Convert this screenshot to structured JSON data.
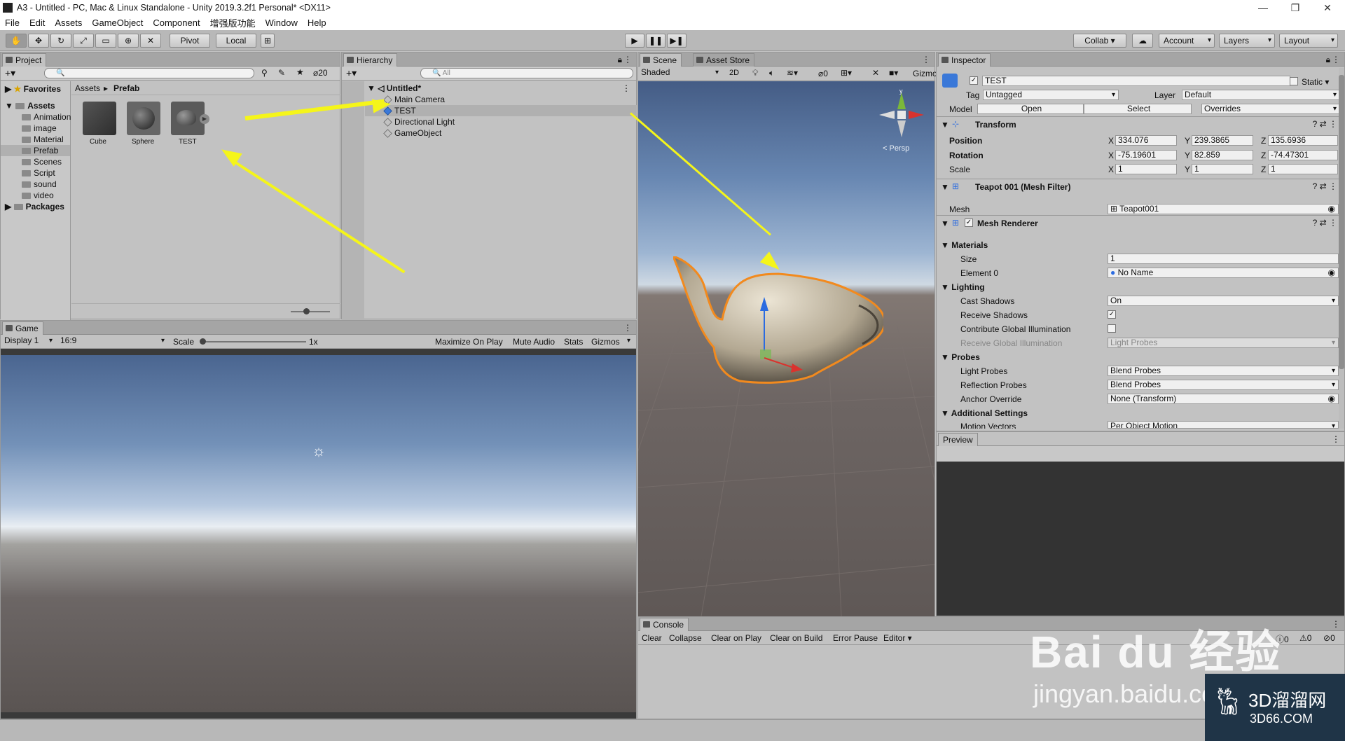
{
  "window": {
    "title": "A3 - Untitled - PC, Mac & Linux Standalone - Unity 2019.3.2f1 Personal* <DX11>",
    "minimize": "—",
    "maximize": "❐",
    "close": "✕"
  },
  "menu": [
    "File",
    "Edit",
    "Assets",
    "GameObject",
    "Component",
    "增强版功能",
    "Window",
    "Help"
  ],
  "toolbar": {
    "pivot": "Pivot",
    "local": "Local",
    "collab": "Collab ▾",
    "account": "Account",
    "layers": "Layers",
    "layout": "Layout"
  },
  "project": {
    "tab": "Project",
    "count": "20",
    "breadcrumb": [
      "Assets",
      "Prefab"
    ],
    "favorites": "Favorites",
    "assets": "Assets",
    "folders": [
      "Animation",
      "image",
      "Material",
      "Prefab",
      "Scenes",
      "Script",
      "sound",
      "video"
    ],
    "packages": "Packages",
    "items": [
      "Cube",
      "Sphere",
      "TEST"
    ]
  },
  "hierarchy": {
    "tab": "Hierarchy",
    "search_placeholder": "All",
    "scene": "Untitled*",
    "objects": [
      "Main Camera",
      "TEST",
      "Directional Light",
      "GameObject"
    ]
  },
  "scene": {
    "tabs": [
      "Scene",
      "Asset Store"
    ],
    "shading": "Shaded",
    "mode2d": "2D",
    "fx_count": "0",
    "gizmos": "Gizmos",
    "persp": "< Persp"
  },
  "game": {
    "tab": "Game",
    "display": "Display 1",
    "aspect": "16:9",
    "scale_label": "Scale",
    "scale_value": "1x",
    "buttons": [
      "Maximize On Play",
      "Mute Audio",
      "Stats",
      "Gizmos"
    ]
  },
  "inspector": {
    "tab": "Inspector",
    "name": "TEST",
    "static": "Static",
    "tag_label": "Tag",
    "tag": "Untagged",
    "layer_label": "Layer",
    "layer": "Default",
    "model_label": "Model",
    "open": "Open",
    "select": "Select",
    "overrides": "Overrides",
    "transform": {
      "title": "Transform",
      "position": {
        "label": "Position",
        "x": "334.076",
        "y": "239.3865",
        "z": "135.6936"
      },
      "rotation": {
        "label": "Rotation",
        "x": "-75.19601",
        "y": "82.859",
        "z": "-74.47301"
      },
      "scale": {
        "label": "Scale",
        "x": "1",
        "y": "1",
        "z": "1"
      }
    },
    "mesh_filter": {
      "title": "Teapot 001 (Mesh Filter)",
      "mesh_label": "Mesh",
      "mesh": "Teapot001"
    },
    "renderer": {
      "title": "Mesh Renderer",
      "materials": "Materials",
      "size_label": "Size",
      "size": "1",
      "element_label": "Element 0",
      "element": "No Name",
      "lighting": "Lighting",
      "cast_label": "Cast Shadows",
      "cast": "On",
      "receive_label": "Receive Shadows",
      "contrib_label": "Contribute Global Illumination",
      "receive_gi_label": "Receive Global Illumination",
      "receive_gi": "Light Probes",
      "probes": "Probes",
      "light_probes_label": "Light Probes",
      "light_probes": "Blend Probes",
      "refl_label": "Reflection Probes",
      "refl": "Blend Probes",
      "anchor_label": "Anchor Override",
      "anchor": "None (Transform)",
      "additional": "Additional Settings",
      "motion_label": "Motion Vectors",
      "motion": "Per Object Motion"
    },
    "preview": "Preview"
  },
  "console": {
    "tab": "Console",
    "buttons": [
      "Clear",
      "Collapse",
      "Clear on Play",
      "Clear on Build",
      "Error Pause",
      "Editor ▾"
    ],
    "counts": [
      "0",
      "0",
      "0"
    ]
  },
  "watermark": {
    "brand": "Bai du 经验",
    "url": "jingyan.baidu.com",
    "badge": "3D溜溜网",
    "badge_url": "3D66.COM"
  },
  "colors": {
    "accent": "#f28a1e",
    "arrow": "#f5f51a",
    "selected": "#b9cbe8"
  }
}
